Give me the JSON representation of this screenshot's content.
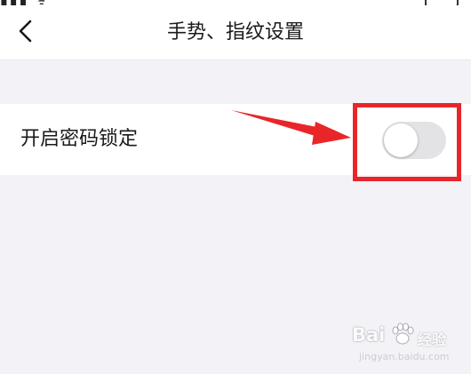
{
  "nav": {
    "title": "手势、指纹设置",
    "back_icon": "chevron-left-icon"
  },
  "settings": {
    "password_lock": {
      "label": "开启密码锁定",
      "enabled": false
    }
  },
  "annotation": {
    "color": "#e8262a",
    "arrow_icon": "arrow-right-icon"
  },
  "watermark": {
    "logo": "Bai",
    "logo_suffix": "经验",
    "url": "jingyan.baidu.com"
  },
  "colors": {
    "background": "#f3f3f7",
    "toggle_off": "#e3e3e6",
    "annotation_red": "#e8262a"
  }
}
